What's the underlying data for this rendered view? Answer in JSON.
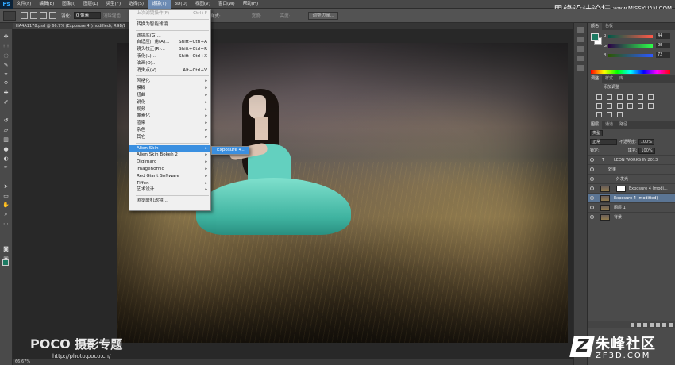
{
  "app": {
    "logo": "Ps"
  },
  "menubar": {
    "items": [
      "文件(F)",
      "编辑(E)",
      "图像(I)",
      "图层(L)",
      "类型(Y)",
      "选择(S)",
      "滤镜(T)",
      "3D(D)",
      "视图(V)",
      "窗口(W)",
      "帮助(H)"
    ],
    "active_index": 6
  },
  "brand": {
    "text": "思缘设计论坛",
    "url": "www.MISSYUAN.COM"
  },
  "options": {
    "feather_label": "羽化:",
    "feather_value": "0 像素",
    "antialias_label": "消除锯齿",
    "style_label": "样式:",
    "width_label": "宽度:",
    "height_label": "高度:",
    "refine_button": "调整边缘..."
  },
  "document": {
    "tab_title": "HA4A1178.psd @ 66.7% (Exposure 4 (modified), RGB/8) *"
  },
  "filter_menu": {
    "items": [
      {
        "label": "上次滤镜操作(F)",
        "shortcut": "Ctrl+F",
        "disabled": true
      },
      {
        "sep": true
      },
      {
        "label": "转换为智能滤镜"
      },
      {
        "sep": true
      },
      {
        "label": "滤镜库(G)..."
      },
      {
        "label": "自适应广角(A)...",
        "shortcut": "Shift+Ctrl+A"
      },
      {
        "label": "镜头校正(R)...",
        "shortcut": "Shift+Ctrl+R"
      },
      {
        "label": "液化(L)...",
        "shortcut": "Shift+Ctrl+X"
      },
      {
        "label": "油画(O)..."
      },
      {
        "label": "消失点(V)...",
        "shortcut": "Alt+Ctrl+V"
      },
      {
        "sep": true
      },
      {
        "label": "风格化",
        "submenu": true
      },
      {
        "label": "模糊",
        "submenu": true
      },
      {
        "label": "扭曲",
        "submenu": true
      },
      {
        "label": "锐化",
        "submenu": true
      },
      {
        "label": "视频",
        "submenu": true
      },
      {
        "label": "像素化",
        "submenu": true
      },
      {
        "label": "渲染",
        "submenu": true
      },
      {
        "label": "杂色",
        "submenu": true
      },
      {
        "label": "其它",
        "submenu": true
      },
      {
        "sep": true
      },
      {
        "label": "Alien Skin",
        "submenu": true,
        "highlighted": true
      },
      {
        "label": "Alien Skin Bokeh 2",
        "submenu": true
      },
      {
        "label": "Digimarc",
        "submenu": true
      },
      {
        "label": "Imagenomic",
        "submenu": true
      },
      {
        "label": "Red Giant Software",
        "submenu": true
      },
      {
        "label": "Tiffen",
        "submenu": true
      },
      {
        "label": "艺术设计",
        "submenu": true
      },
      {
        "sep": true
      },
      {
        "label": "浏览联机滤镜..."
      }
    ],
    "submenu_item": "Exposure 4...",
    "submenu_arrow": "▸"
  },
  "statusbar": {
    "zoom": "66.67%"
  },
  "watermark": {
    "poco": "POCO",
    "poco_zh": "摄影专题",
    "url": "http://photo.poco.cn/"
  },
  "color_panel": {
    "tabs": [
      "颜色",
      "色板"
    ],
    "sliders": [
      {
        "label": "R",
        "value": "44"
      },
      {
        "label": "G",
        "value": "88"
      },
      {
        "label": "B",
        "value": "72"
      }
    ],
    "fg_color": "#1c7a62"
  },
  "adjust_panel": {
    "tabs": [
      "调整",
      "样式",
      "库"
    ],
    "title": "添加调整"
  },
  "layers_panel": {
    "tabs": [
      "图层",
      "通道",
      "路径"
    ],
    "kind_label": "类型",
    "blend_mode": "正常",
    "opacity_label": "不透明度:",
    "opacity_value": "100%",
    "lock_label": "锁定:",
    "fill_label": "填充:",
    "fill_value": "100%",
    "layers": [
      {
        "name": "LEON WORKS IN 2013",
        "type": "text"
      },
      {
        "name": "效果",
        "type": "effect"
      },
      {
        "name": "外发光",
        "type": "effect"
      },
      {
        "name": "Exposure 4 (modi...",
        "type": "masked"
      },
      {
        "name": "Exposure 4 (modified)",
        "type": "image",
        "selected": true
      },
      {
        "name": "图层 1",
        "type": "image"
      },
      {
        "name": "背景",
        "type": "image"
      }
    ]
  },
  "site_logo": {
    "zh": "朱峰社区",
    "en": "ZF3D.COM"
  }
}
